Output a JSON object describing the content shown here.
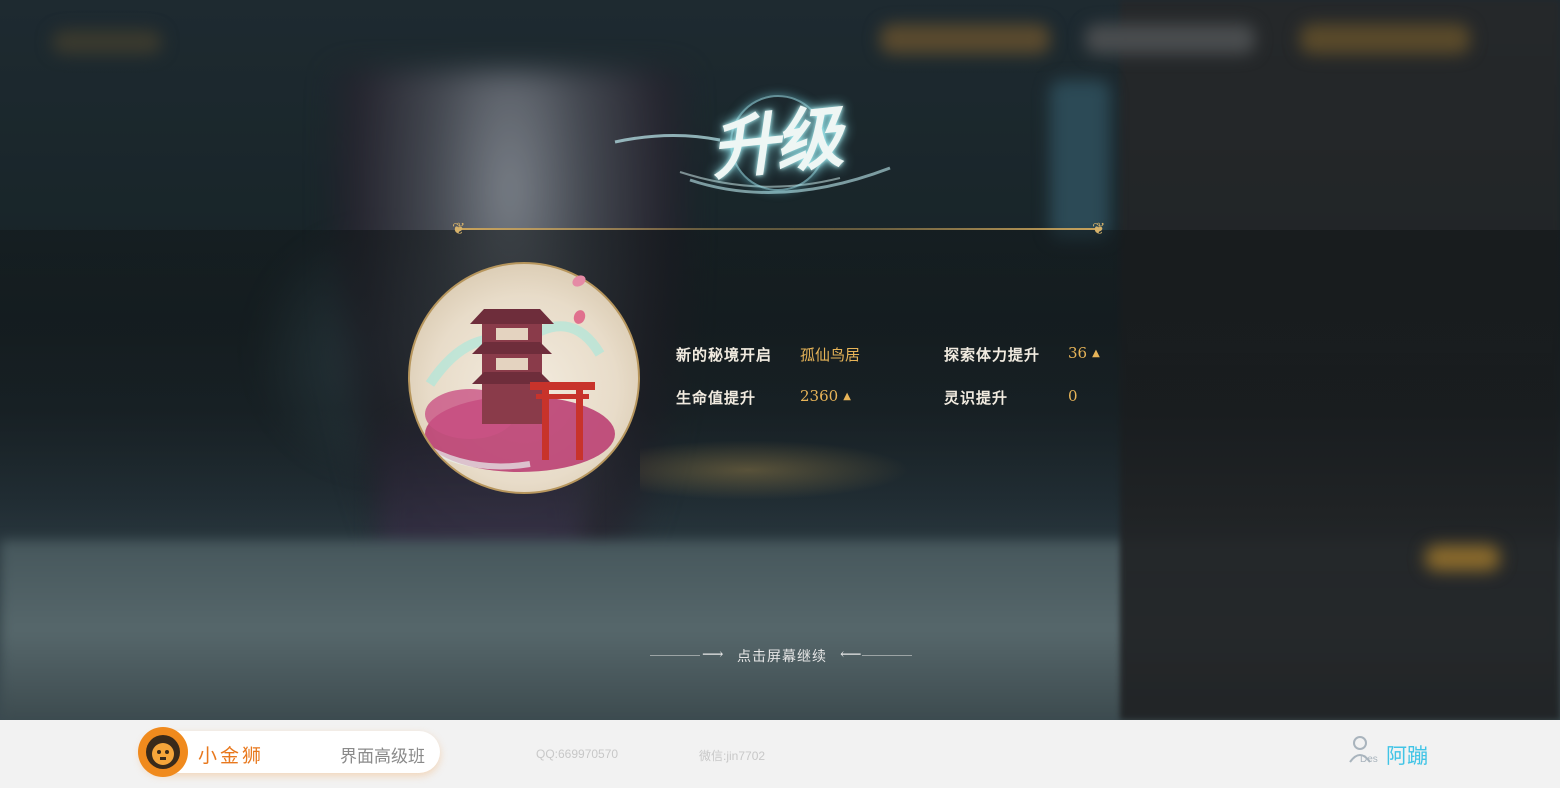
{
  "overlay": {
    "title": "升级",
    "stats": [
      {
        "label": "新的秘境开启",
        "value": "孤仙鸟居",
        "trend": ""
      },
      {
        "label": "探索体力提升",
        "value": "36",
        "trend": "▲"
      },
      {
        "label": "生命值提升",
        "value": "2360",
        "trend": "▲"
      },
      {
        "label": "灵识提升",
        "value": "0",
        "trend": ""
      }
    ],
    "continue_label": "点击屏幕继续",
    "emblem_icon": "torii-pagoda-emblem-icon",
    "accent_color": "#e7b458"
  },
  "footer": {
    "brand_name": "小金狮",
    "brand_sub": "界面高级班",
    "qq": "QQ:669970570",
    "wechat": "微信:jin7702",
    "author_tag": "Des",
    "author": "阿蹦"
  }
}
